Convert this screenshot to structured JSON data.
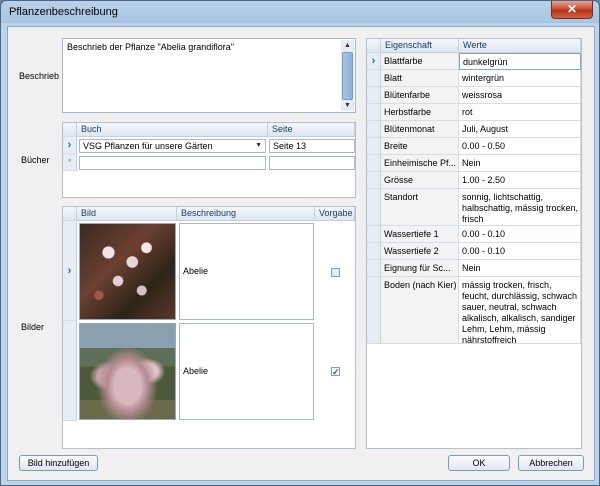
{
  "window": {
    "title": "Pflanzenbeschreibung",
    "close_glyph": "✕"
  },
  "labels": {
    "beschrieb": "Beschrieb",
    "buecher": "Bücher",
    "bilder": "Bilder"
  },
  "beschrieb_text": "Beschrieb der Pflanze \"Abelia grandiflora\"",
  "books": {
    "headers": {
      "buch": "Buch",
      "seite": "Seite"
    },
    "rows": [
      {
        "buch": "VSG Pflanzen für unsere Gärten",
        "seite": "Seite 13"
      }
    ],
    "new_row_marker": "*",
    "current_marker": "›"
  },
  "images": {
    "headers": {
      "bild": "Bild",
      "beschreibung": "Beschreibung",
      "vorgabe": "Vorgabe"
    },
    "rows": [
      {
        "beschreibung": "Abelie",
        "vorgabe": false
      },
      {
        "beschreibung": "Abelie",
        "vorgabe": true
      }
    ],
    "check_glyph": "✓"
  },
  "properties": {
    "headers": {
      "eigenschaft": "Eigenschaft",
      "werte": "Werte"
    },
    "rows": [
      {
        "name": "Blattfarbe",
        "value": "dunkelgrün"
      },
      {
        "name": "Blatt",
        "value": "wintergrün"
      },
      {
        "name": "Blütenfarbe",
        "value": "weissrosa"
      },
      {
        "name": "Herbstfarbe",
        "value": "rot"
      },
      {
        "name": "Blütenmonat",
        "value": "Juli, August"
      },
      {
        "name": "Breite",
        "value": "0.00 - 0.50"
      },
      {
        "name": "Einheimische Pf...",
        "value": "Nein"
      },
      {
        "name": "Grösse",
        "value": "1.00 - 2.50"
      },
      {
        "name": "Standort",
        "value": "sonnig, lichtschattig, halbschattig, mässig trocken, frisch"
      },
      {
        "name": "Wassertiefe 1",
        "value": "0.00 - 0.10"
      },
      {
        "name": "Wassertiefe 2",
        "value": "0.00 - 0.10"
      },
      {
        "name": "Eignung für Sc...",
        "value": "Nein"
      },
      {
        "name": "Boden (nach Kier)",
        "value": "mässig trocken, frisch, feucht, durchlässig, schwach sauer, neutral, schwach alkalisch, alkalisch, sandiger Lehm, Lehm, mässig nährstoffreich"
      }
    ]
  },
  "buttons": {
    "add_image": "Bild hinzufügen",
    "ok": "OK",
    "cancel": "Abbrechen"
  }
}
